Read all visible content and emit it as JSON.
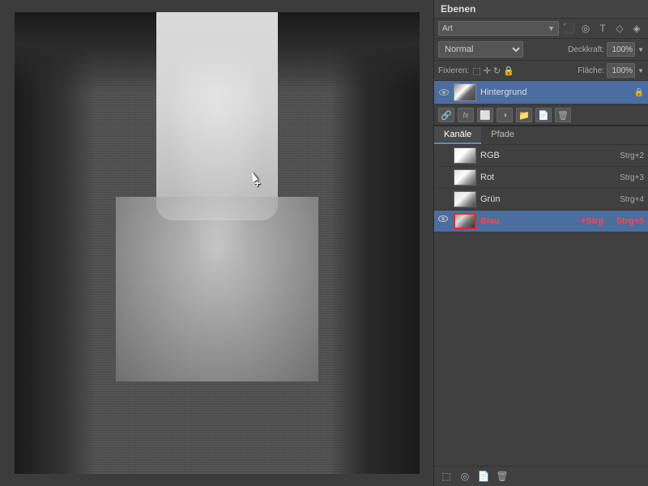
{
  "panel": {
    "title": "Ebenen",
    "search_placeholder": "Art",
    "blend_mode": "Normal",
    "opacity_label": "Deckkraft:",
    "opacity_value": "100%",
    "fix_label": "Fixieren:",
    "flache_label": "Fläche:",
    "flache_value": "100%"
  },
  "layers": [
    {
      "name": "Hintergrund",
      "visible": true,
      "selected": true,
      "locked": true
    }
  ],
  "channels_tabs": [
    {
      "label": "Kanäle",
      "active": true
    },
    {
      "label": "Pfade",
      "active": false
    }
  ],
  "channels": [
    {
      "id": "rgb",
      "name": "RGB",
      "shortcut": "Strg+2",
      "active": false,
      "thumb": "rgb"
    },
    {
      "id": "rot",
      "name": "Rot",
      "shortcut": "Strg+3",
      "active": false,
      "thumb": "red"
    },
    {
      "id": "gruen",
      "name": "Grün",
      "shortcut": "Strg+4",
      "active": false,
      "thumb": "green"
    },
    {
      "id": "blau",
      "name": "Blau",
      "shortcut": "+Strg   Strg+5",
      "active": true,
      "thumb": "blue"
    }
  ],
  "icons": {
    "eye": "👁",
    "lock": "🔒",
    "search": "🔍",
    "text": "T",
    "link": "🔗",
    "fx": "fx",
    "mask": "⬜",
    "folder": "📁",
    "new": "📄",
    "delete": "🗑"
  }
}
